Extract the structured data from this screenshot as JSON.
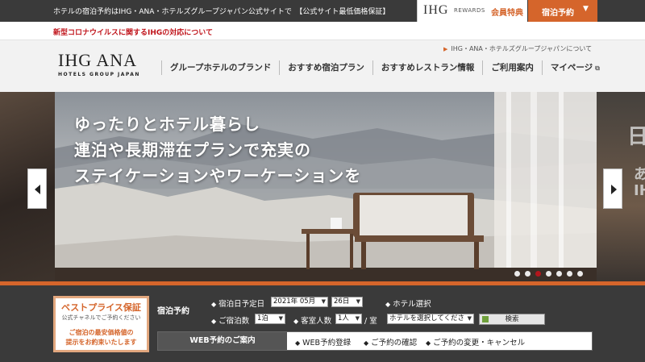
{
  "topbar": {
    "message": "ホテルの宿泊予約はIHG・ANA・ホテルズグループジャパン公式サイトで　【公式サイト最低価格保証】",
    "rewards_logo": "IHG",
    "rewards_text": "REWARDS",
    "rewards_perk": "会員特典",
    "reserve_label": "宿泊予約",
    "reserve_caret": "▼"
  },
  "notice": {
    "covid": "新型コロナウイルスに関するIHGの対応について"
  },
  "header": {
    "about_link": "IHG・ANA・ホテルズグループジャパンについて",
    "brand_main": "IHG ANA",
    "brand_sub": "HOTELS GROUP JAPAN",
    "nav": [
      {
        "label": "グループホテルのブランド"
      },
      {
        "label": "おすすめ宿泊プラン"
      },
      {
        "label": "おすすめレストラン情報"
      },
      {
        "label": "ご利用案内"
      },
      {
        "label": "マイページ"
      }
    ]
  },
  "hero": {
    "headline_lines": [
      "ゆったりとホテル暮らし",
      "連泊や長期滞在プランで充実の",
      "ステイケーションやワーケーションを"
    ],
    "next_slide_peek": [
      "日",
      "あ",
      "IH"
    ],
    "slides_total": 7,
    "active_slide": 3
  },
  "booking": {
    "best_price_title": "ベストプライス保証",
    "best_price_sub": "公式チャネルでご予約ください",
    "best_price_note_1": "ご宿泊の最安価格値の",
    "best_price_note_2": "提示をお約束いたします",
    "section_label": "宿泊予約",
    "checkin_label": "宿泊日予定日",
    "checkin_month": "2021年 05月",
    "checkin_day": "26日",
    "hotel_label": "ホテル選択",
    "nights_label": "ご宿泊数",
    "nights_value": "1泊",
    "guests_label": "客室人数",
    "guests_value": "1人",
    "per_room": "/ 室",
    "hotel_placeholder": "ホテルを選択してくださ",
    "search_label": "検索",
    "web_label": "WEB予約のご案内",
    "web_links": [
      "WEB予約登録",
      "ご予約の確認",
      "ご予約の変更・キャンセル"
    ]
  },
  "colors": {
    "accent": "#d5652b",
    "alert": "#c0141b",
    "dark": "#3a3a3a"
  }
}
